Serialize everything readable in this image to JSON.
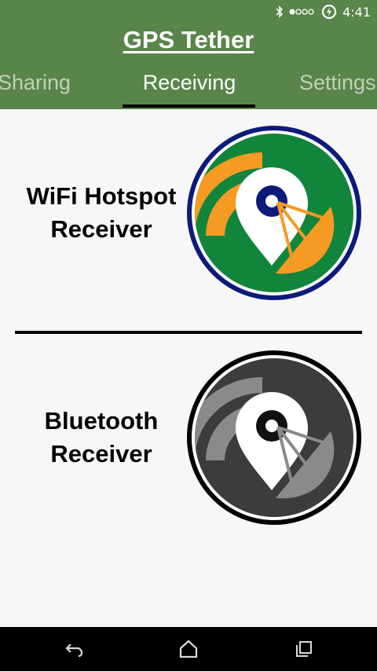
{
  "status_bar": {
    "time": "4:41",
    "icons": [
      "bluetooth-icon",
      "signal-dots-icon",
      "battery-saver-icon"
    ]
  },
  "app": {
    "title": "GPS Tether"
  },
  "tabs": [
    {
      "label": "Sharing",
      "selected": false
    },
    {
      "label": "Receiving",
      "selected": true
    },
    {
      "label": "Settings",
      "selected": false
    }
  ],
  "options": [
    {
      "line1": "WiFi Hotspot",
      "line2": "Receiver",
      "icon": "wifi-hotspot-receiver-icon",
      "colors": {
        "ring": "#0e1a7a",
        "fill": "#12853c",
        "accent": "#f59a23"
      }
    },
    {
      "line1": "Bluetooth",
      "line2": "Receiver",
      "icon": "bluetooth-receiver-icon",
      "colors": {
        "ring": "#000000",
        "fill": "#3c3c3c",
        "accent": "#8a8a8a"
      }
    }
  ],
  "nav_bar": {
    "icons": [
      "back-icon",
      "home-icon",
      "recents-icon"
    ]
  },
  "colors": {
    "app_bar": "#59854a",
    "background": "#f7f7f7"
  }
}
